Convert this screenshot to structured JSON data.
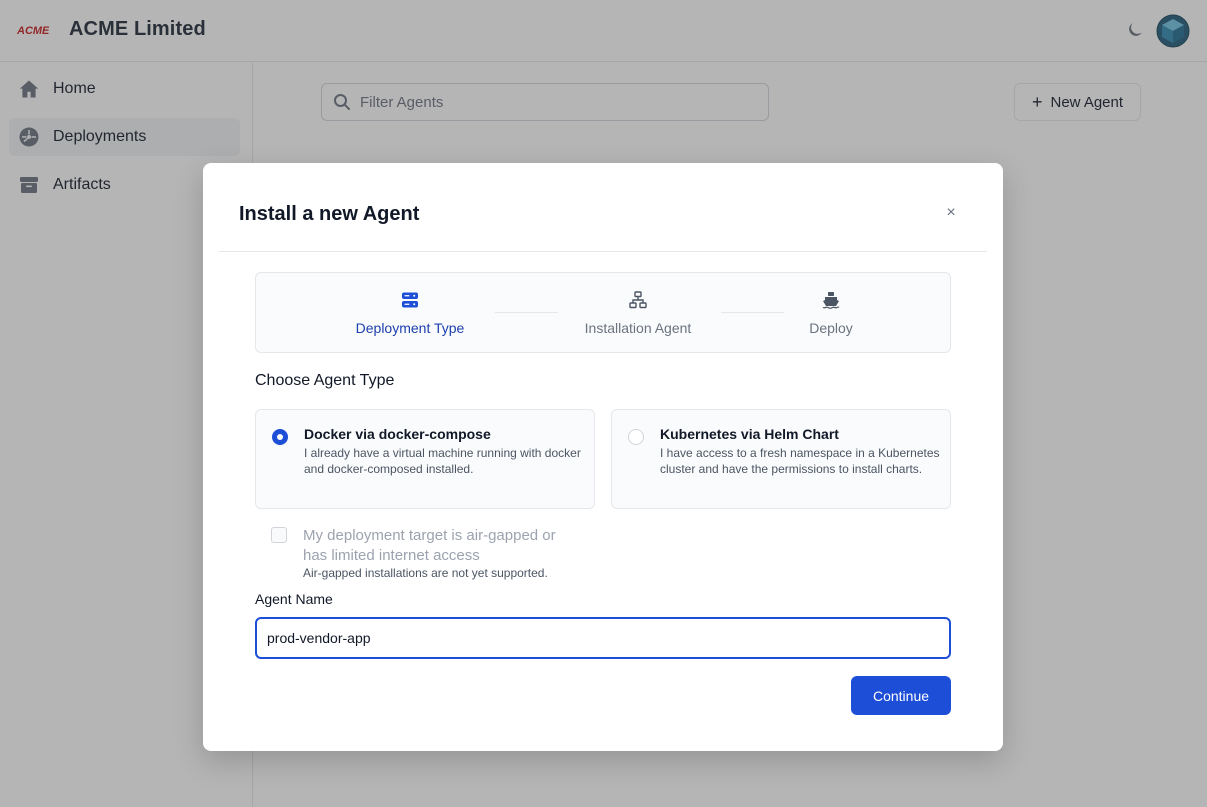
{
  "header": {
    "logo_text": "ACME",
    "org_name": "ACME Limited",
    "theme_toggle_icon": "moon-icon",
    "avatar_icon": "cube-avatar"
  },
  "sidebar": {
    "items": [
      {
        "label": "Home",
        "icon": "home-icon",
        "active": false
      },
      {
        "label": "Deployments",
        "icon": "dashboard-icon",
        "active": true
      },
      {
        "label": "Artifacts",
        "icon": "archive-box-icon",
        "active": false
      }
    ]
  },
  "toolbar": {
    "filter_placeholder": "Filter Agents",
    "filter_value": "",
    "new_agent_label": "New Agent"
  },
  "modal": {
    "title": "Install a new Agent",
    "close_glyph": "×",
    "steps": [
      {
        "label": "Deployment Type",
        "icon": "server-stack-icon",
        "active": true
      },
      {
        "label": "Installation Agent",
        "icon": "network-icon",
        "active": false
      },
      {
        "label": "Deploy",
        "icon": "ship-icon",
        "active": false
      }
    ],
    "section_title": "Choose Agent Type",
    "options": [
      {
        "title": "Docker via docker-compose",
        "description": "I already have a virtual machine running with docker and docker-composed installed.",
        "selected": true
      },
      {
        "title": "Kubernetes via Helm Chart",
        "description": "I have access to a fresh namespace in a Kubernetes cluster and have the permissions to install charts.",
        "selected": false
      }
    ],
    "airgap": {
      "label": "My deployment target is air-gapped or has limited internet access",
      "help": "Air-gapped installations are not yet supported.",
      "checked": false,
      "disabled": true
    },
    "agent_name": {
      "label": "Agent Name",
      "value": "prod-vendor-app"
    },
    "continue_label": "Continue"
  },
  "colors": {
    "primary": "#1d4ed8",
    "logo_red": "#c81e1e",
    "overlay": "rgba(60,60,60,0.38)"
  }
}
